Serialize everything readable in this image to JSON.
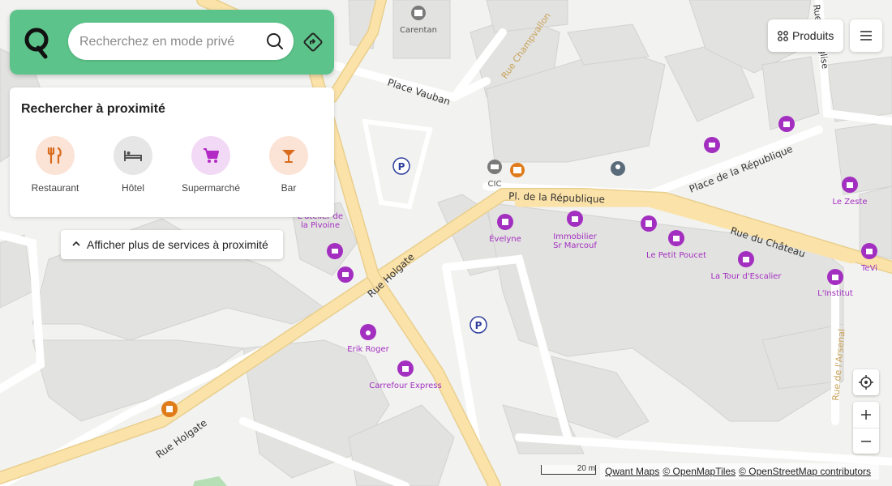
{
  "search": {
    "placeholder": "Recherchez en mode privé"
  },
  "nearby": {
    "title": "Rechercher à proximité",
    "categories": [
      {
        "label": "Restaurant",
        "icon": "restaurant-icon",
        "bg": "#fbe3d6",
        "fg": "#d96b1c"
      },
      {
        "label": "Hôtel",
        "icon": "hotel-icon",
        "bg": "#e6e6e6",
        "fg": "#555555"
      },
      {
        "label": "Supermarché",
        "icon": "cart-icon",
        "bg": "#f2d9f5",
        "fg": "#b32ac4"
      },
      {
        "label": "Bar",
        "icon": "cocktail-icon",
        "bg": "#fbe3d6",
        "fg": "#d96b1c"
      }
    ],
    "more_label": "Afficher plus de services à proximité"
  },
  "topbar": {
    "products_label": "Produits"
  },
  "map": {
    "streets": {
      "rue_holgate_1": "Rue Holgate",
      "rue_holgate_2": "Rue Holgate",
      "pl_republique": "Pl. de la République",
      "place_republique": "Place de la République",
      "rue_chateau": "Rue du Château",
      "place_vauban": "Place Vauban",
      "rue_champvallon": "Rue Champvallon",
      "rue_arsenal": "Rue de l'Arsenal",
      "rue_eglise": "Rue de l'Église"
    },
    "pois": {
      "carentan": "Carentan",
      "cic": "CIC",
      "evelyne": "Évelyne",
      "immobilier": "Immobilier",
      "sr_marcouf": "Sr Marcouf",
      "petit_poucet": "Le Petit Poucet",
      "tour_escalier": "La Tour d'Escalier",
      "linstitut": "L'Institut",
      "le_zeste": "Le Zeste",
      "tevi": "TeVi",
      "atelier": "L'atelier de",
      "pivoine": "la Pivoine",
      "erik_roger": "Erik Roger",
      "carrefour": "Carrefour Express"
    }
  },
  "scale": {
    "label": "20 m"
  },
  "attribution": {
    "qwant": "Qwant Maps",
    "omt": "© OpenMapTiles",
    "osm": "© OpenStreetMap contributors"
  },
  "colors": {
    "brand_green": "#5cc48a",
    "road_yellow": "#fbe2a8",
    "poi_purple": "#a32fc0",
    "poi_orange": "#e07b1a",
    "parking_blue": "#2f3f9c"
  }
}
